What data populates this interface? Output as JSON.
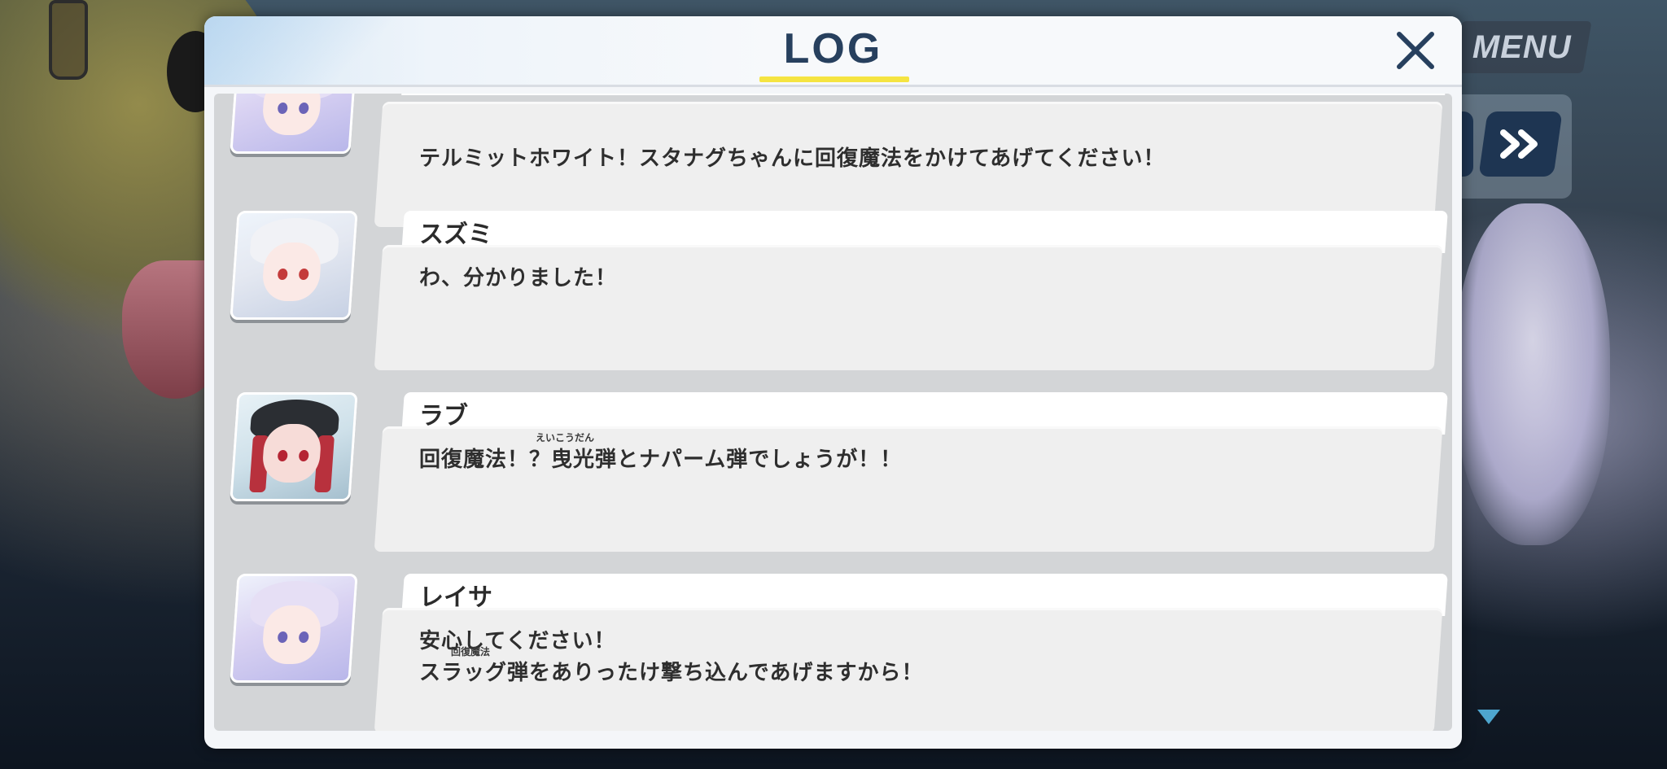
{
  "header": {
    "title": "LOG"
  },
  "hud": {
    "menu_label": "MENU"
  },
  "entries": [
    {
      "speaker": "",
      "avatar_icon": "reisa-portrait-icon",
      "lines": [
        "テルミットホワイト！スタナグちゃんに回復魔法をかけてあげてください！"
      ]
    },
    {
      "speaker": "スズミ",
      "avatar_icon": "suzumi-portrait-icon",
      "lines": [
        "わ、分かりました！"
      ]
    },
    {
      "speaker": "ラブ",
      "avatar_icon": "love-portrait-icon",
      "lines": [
        "回復魔法！？曳光弾とナパーム弾でしょうが！！"
      ],
      "ruby": "えいこうだん"
    },
    {
      "speaker": "レイサ",
      "avatar_icon": "reisa-portrait-icon",
      "lines": [
        "安心してください！",
        "スラッグ弾をありったけ撃ち込んであげますから！"
      ],
      "ruby": "回復魔法"
    }
  ],
  "colors": {
    "title": "#27405e",
    "underline": "#f5e441",
    "fastforward": "#1e3552"
  }
}
